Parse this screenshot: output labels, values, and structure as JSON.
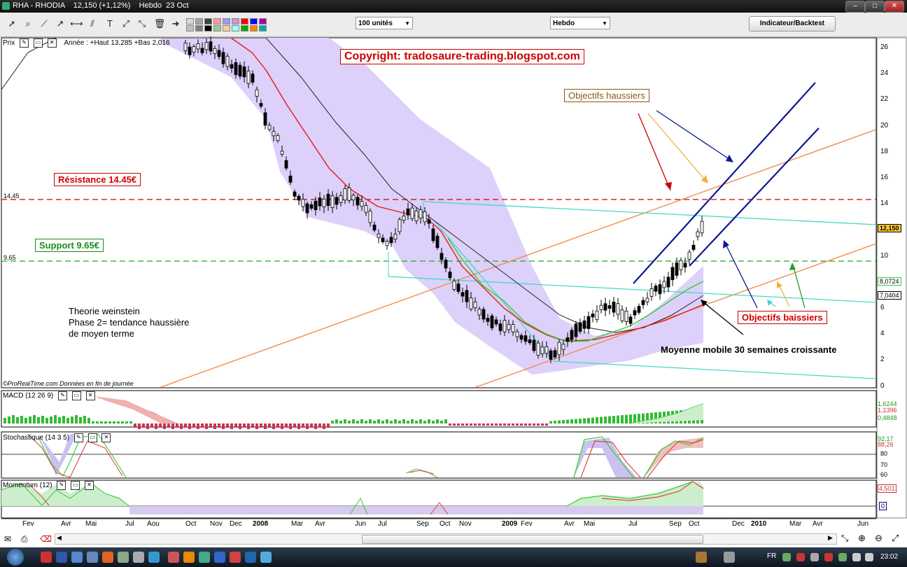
{
  "window": {
    "title": "RHA - RHODIA    12,150 (+1,12%)    Hebdo  23 Oct",
    "controls": [
      "–",
      "□",
      "✕"
    ]
  },
  "toolbar": {
    "units_select": "100 unités",
    "period_select": "Hebdo",
    "indicator_button": "Indicateur/Backtest",
    "tools": [
      "cursor-icon",
      "zoom-icon",
      "line-icon",
      "ray-icon",
      "horizontal-line-icon",
      "channel-icon",
      "text-icon",
      "fibonacci-icon",
      "arrows-icon",
      "trash-icon",
      "arrow-right-icon"
    ],
    "palette": [
      "#d9d9d9",
      "#bfbfbf",
      "#a6a6a6",
      "#7f7f7f",
      "#404040",
      "#000000",
      "#ff9999",
      "#99cc99",
      "#9999ff",
      "#ffcc99",
      "#cc99cc",
      "#99ffff",
      "#ff0000",
      "#00aa00",
      "#0000ff",
      "#ff8000",
      "#aa00aa",
      "#00aaaa"
    ]
  },
  "price_panel": {
    "label": "Prix",
    "info": "Année : +Haut 13,285 +Bas 2,016",
    "copyright": "Copyright: tradosaure-trading.blogspot.com",
    "resistance": "Résistance 14.45€",
    "support": "Support 9.65€",
    "resistance_level": "14,45",
    "support_level": "9,65",
    "objectifs_haussiers": "Objectifs haussiers",
    "objectifs_baissiers": "Objectifs baissiers",
    "theory_line1": "Theorie weinstein",
    "theory_line2": "Phase 2= tendance haussière",
    "theory_line3": "de moyen terme",
    "mm30": "Moyenne mobile 30 semaines croissante",
    "source": "©ProRealTime.com  Données en fin de journée",
    "y_ticks": [
      "26",
      "24",
      "22",
      "20",
      "18",
      "16",
      "14",
      "12",
      "10",
      "8",
      "6",
      "4",
      "2",
      "0"
    ],
    "last_price": "12,150",
    "tag_green": "8,0724",
    "tag_black": "7,0404"
  },
  "macd_panel": {
    "label": "MACD (12 26 9)",
    "tags": [
      "1,6244",
      "1,1396",
      "0,4848"
    ]
  },
  "stoch_panel": {
    "label": "Stochastique (14 3 5)",
    "tags": [
      "92,17",
      "88,26"
    ],
    "ticks": [
      "80",
      "70",
      "60"
    ]
  },
  "momentum_panel": {
    "label": "Momentum (12)",
    "tags": [
      "4,501",
      "0"
    ]
  },
  "x_axis": [
    "Fev",
    "Avr",
    "Mai",
    "Jul",
    "Aou",
    "Oct",
    "Nov",
    "Dec",
    "2008",
    "Mar",
    "Avr",
    "Jun",
    "Jul",
    "Sep",
    "Oct",
    "Nov",
    "2009",
    "Fev",
    "Avr",
    "Mai",
    "Jul",
    "Sep",
    "Oct",
    "Dec",
    "2010",
    "Mar",
    "Avr",
    "Jun"
  ],
  "taskbar": {
    "lang": "FR",
    "clock": "23:02"
  },
  "colors": {
    "resistance": "#cc0000",
    "support": "#22aa22",
    "bollinger": "#ddd0fa",
    "ma_red": "#e02010",
    "ma_black": "#222222",
    "ma_green": "#33cc33",
    "trend_orange": "#ee8844",
    "trend_cyan": "#44d8c8",
    "channel_navy": "#0a1a90"
  }
}
